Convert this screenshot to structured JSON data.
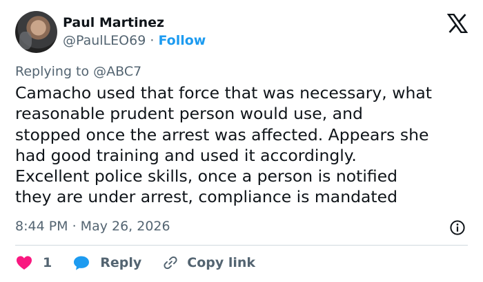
{
  "author": {
    "name": "Paul Martinez",
    "handle": "@PaulLEO69",
    "separator": "·",
    "follow_label": "Follow"
  },
  "reply_context": "Replying to @ABC7",
  "tweet_lines": [
    "Camacho used that force that was necessary, what",
    "reasonable prudent person would use, and",
    "stopped once the arrest was affected. Appears she",
    "had good training and used it accordingly.",
    "Excellent police skills, once a person is notified",
    "they are under arrest, compliance is mandated"
  ],
  "timestamp": "8:44 PM · May 26, 2026",
  "actions": {
    "like_count": "1",
    "reply_label": "Reply",
    "copy_label": "Copy link"
  },
  "icons": {
    "logo": "x-logo-icon",
    "info": "info-icon",
    "heart": "heart-icon",
    "reply": "speech-bubble-icon",
    "link": "link-icon"
  },
  "colors": {
    "text": "#0f1419",
    "muted": "#536471",
    "accent": "#1d9bf0",
    "heart": "#f91880",
    "divider": "#cfd9de"
  }
}
